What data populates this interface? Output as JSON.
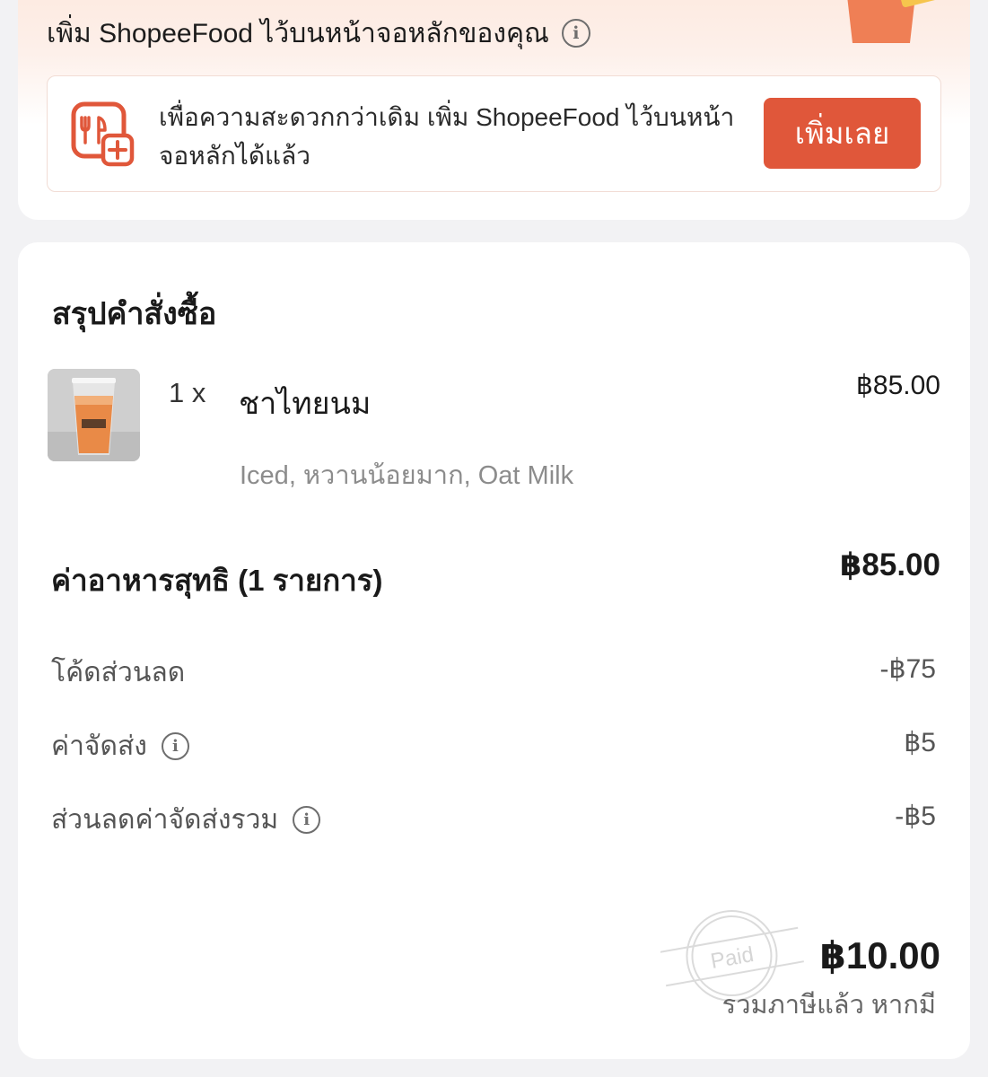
{
  "banner": {
    "title": "เพิ่ม ShopeeFood ไว้บนหน้าจอหลักของคุณ",
    "info_icon": "info-icon",
    "decoration_icon": "gift-box-icon",
    "decoration_badge": "%",
    "promo": {
      "icon": "shopeefood-add-icon",
      "text": "เพื่อความสะดวกกว่าเดิม เพิ่ม ShopeeFood ไว้บนหน้าจอหลักได้แล้ว",
      "button_label": "เพิ่มเลย"
    }
  },
  "summary": {
    "title": "สรุปคำสั่งซื้อ",
    "items": [
      {
        "quantity": "1 x",
        "name": "ชาไทยนม",
        "price": "฿85.00",
        "options": "Iced, หวานน้อยมาก, Oat Milk",
        "thumbnail": "thai-milk-tea-image"
      }
    ],
    "subtotal_label": "ค่าอาหารสุทธิ (1 รายการ)",
    "subtotal_value": "฿85.00",
    "discount_code_label": "โค้ดส่วนลด",
    "discount_code_value": "-฿75",
    "delivery_fee_label": "ค่าจัดส่ง",
    "delivery_fee_value": "฿5",
    "delivery_discount_label": "ส่วนลดค่าจัดส่งรวม",
    "delivery_discount_value": "-฿5",
    "stamp_text": "Paid",
    "total_value": "฿10.00",
    "total_note": "รวมภาษีแล้ว หากมี"
  },
  "colors": {
    "accent": "#e0573a",
    "background": "#f2f2f4",
    "card": "#ffffff",
    "muted_text": "#8c8c8c"
  }
}
